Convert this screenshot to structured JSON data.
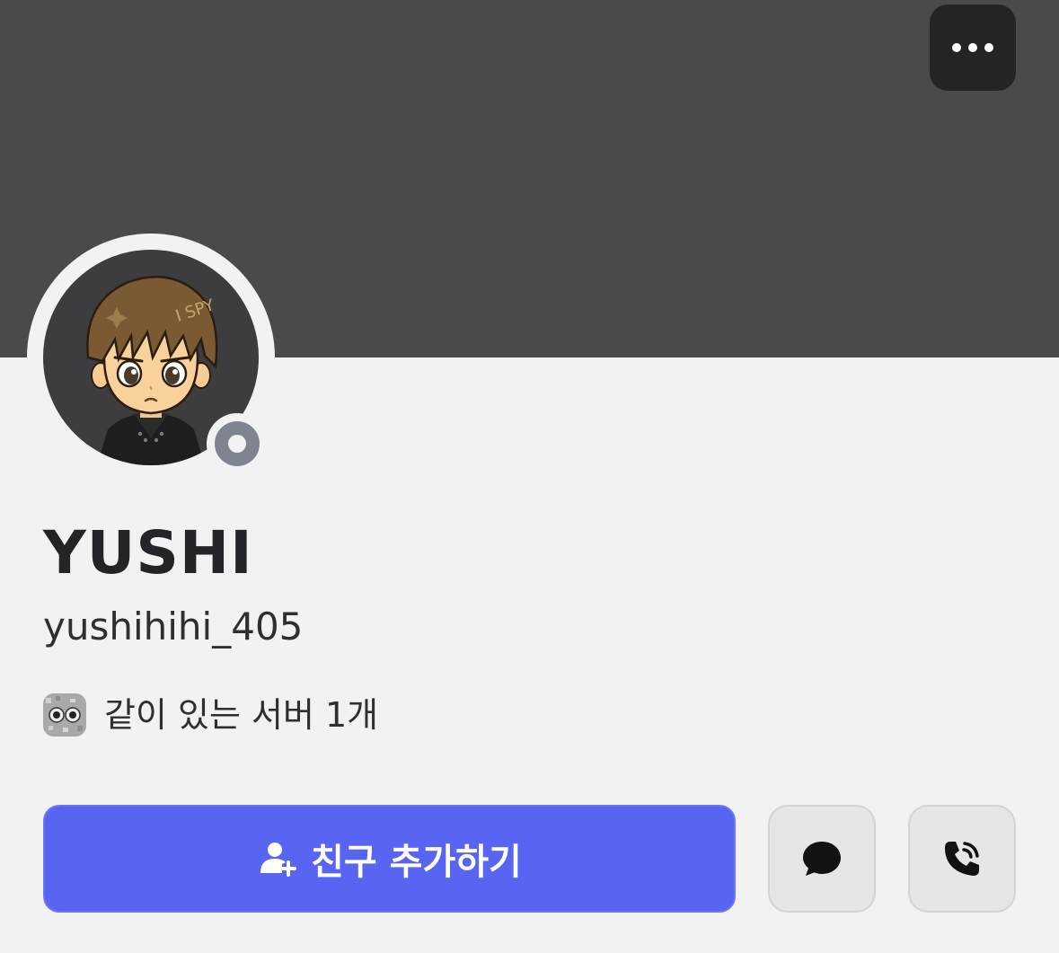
{
  "profile": {
    "display_name": "YUSHI",
    "username": "yushihihi_405",
    "status": "offline",
    "avatar_icon": "anime-boy-avatar",
    "avatar_caption": "I SPY"
  },
  "mutual": {
    "server_icon": "server-icon",
    "text": "같이 있는 서버 1개"
  },
  "actions": {
    "add_friend_label": "친구 추가하기",
    "add_friend_icon": "add-friend-icon",
    "message_icon": "message-icon",
    "call_icon": "call-icon",
    "more_icon": "more-icon"
  },
  "colors": {
    "banner": "#4a4a4b",
    "accent": "#5865f2",
    "status_offline": "#80848e",
    "background": "#f2f2f3"
  }
}
